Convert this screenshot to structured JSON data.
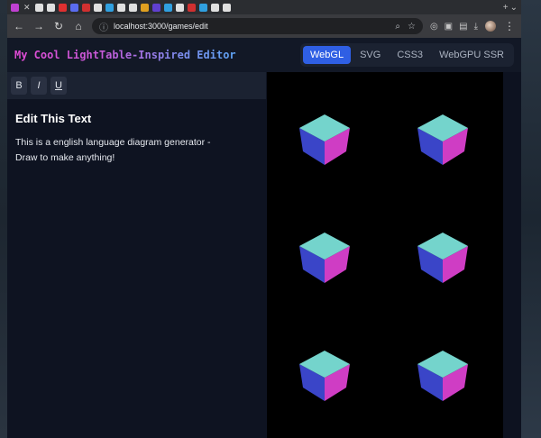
{
  "browser": {
    "url": "localhost:3000/games/edit",
    "tab_favicon_colors": [
      "#c040d0",
      "#e0e0e0",
      "#e0e0e0",
      "#e03030",
      "#5a6cf0",
      "#d03030",
      "#e0e0e0",
      "#30a0e0",
      "#e0e0e0",
      "#e0e0e0",
      "#e0a020",
      "#6040d0",
      "#30a0e0",
      "#e0e0e0",
      "#d03030",
      "#30a0e0",
      "#e0e0e0",
      "#e0e0e0"
    ]
  },
  "app": {
    "title": "My Cool LightTable-Inspired Editor",
    "renderer_tabs": [
      {
        "label": "WebGL",
        "active": true
      },
      {
        "label": "SVG",
        "active": false
      },
      {
        "label": "CSS3",
        "active": false
      },
      {
        "label": "WebGPU SSR",
        "active": false
      }
    ]
  },
  "editor": {
    "format_buttons": [
      {
        "label": "B",
        "name": "bold"
      },
      {
        "label": "I",
        "name": "italic"
      },
      {
        "label": "U",
        "name": "underline"
      }
    ],
    "heading": "Edit This Text",
    "body": "This is a english language diagram generator - Draw to make anything!"
  },
  "canvas": {
    "cube_count": 6,
    "cube_colors": {
      "top": "#74d4cc",
      "left": "#3a45c8",
      "right": "#cf3dc4"
    }
  }
}
